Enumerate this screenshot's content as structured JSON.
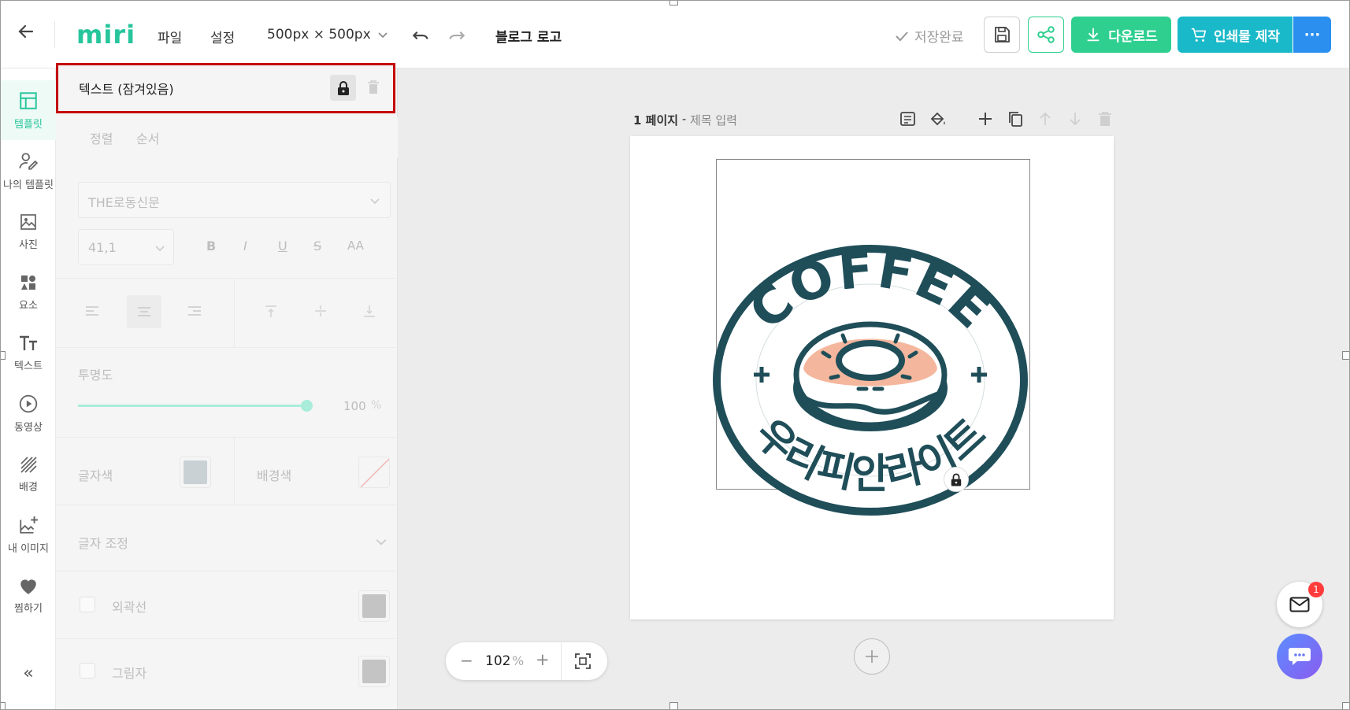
{
  "app": {
    "logo": "miri"
  },
  "topbar": {
    "menu_file": "파일",
    "menu_settings": "설정",
    "size_label": "500px × 500px",
    "doc_title": "블로그 로고",
    "save_status": "저장완료",
    "download_label": "다운로드",
    "print_label": "인쇄물 제작",
    "more_label": "···"
  },
  "sidebar": {
    "items": [
      {
        "label": "템플릿",
        "icon": "template-icon",
        "active": true
      },
      {
        "label": "나의 템플릿",
        "icon": "my-template-icon"
      },
      {
        "label": "사진",
        "icon": "photo-icon"
      },
      {
        "label": "요소",
        "icon": "elements-icon"
      },
      {
        "label": "텍스트",
        "icon": "text-icon"
      },
      {
        "label": "동영상",
        "icon": "video-icon"
      },
      {
        "label": "배경",
        "icon": "background-icon"
      },
      {
        "label": "내 이미지",
        "icon": "my-image-icon"
      },
      {
        "label": "찜하기",
        "icon": "heart-icon"
      }
    ],
    "collapse": "«"
  },
  "panel": {
    "header_title": "텍스트 (잠겨있음)",
    "tab_align": "정렬",
    "tab_order": "순서",
    "font_name": "THE로동신문",
    "font_size": "41,1",
    "style_bold": "B",
    "style_italic": "I",
    "style_underline": "U",
    "style_strike": "S",
    "style_case": "AA",
    "opacity_label": "투명도",
    "opacity_value": "100",
    "opacity_unit": "%",
    "opacity_level": 1.0,
    "text_color_label": "글자색",
    "bg_color_label": "배경색",
    "text_adjust_label": "글자 조정",
    "outline_label": "외곽선",
    "shadow_label": "그림자"
  },
  "canvas": {
    "page_label": "1 페이지",
    "page_sep": " - ",
    "page_title_placeholder": "제목 입력",
    "logo_top_text": "COFFEE",
    "logo_bottom_text": "우리피안라이트"
  },
  "zoom": {
    "value": "102",
    "unit": "%",
    "minus": "−",
    "plus": "+"
  },
  "chat": {
    "badge": "1"
  },
  "colors": {
    "accent": "#27c59b",
    "download": "#2ecf8f",
    "print": "#1ab9c9",
    "more": "#2b8ff0",
    "logo_dark": "#1f4e59",
    "donut": "#f4b79d",
    "lock_border": "#c40000"
  }
}
